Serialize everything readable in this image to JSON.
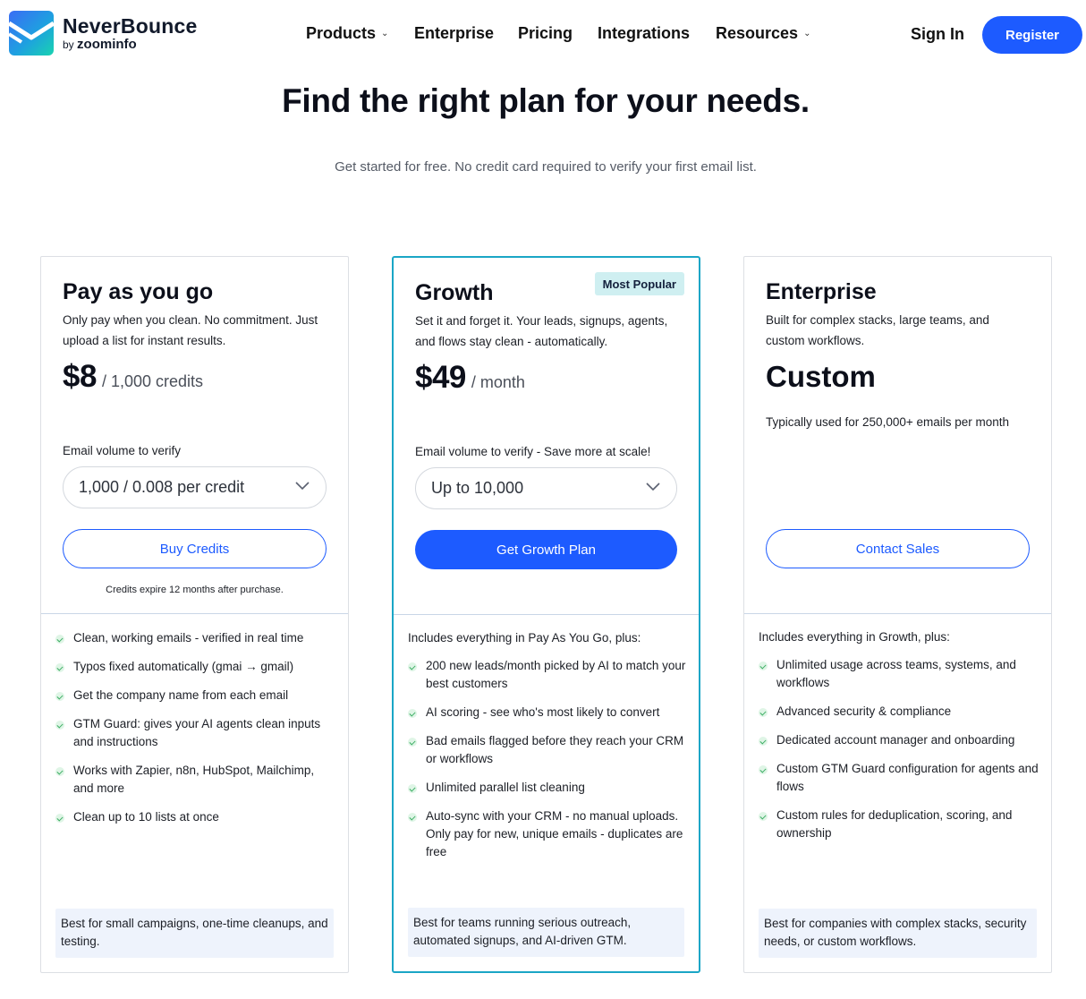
{
  "header": {
    "brand": "NeverBounce",
    "brand_by": "by",
    "brand_parent": "zoominfo",
    "nav": [
      {
        "label": "Products",
        "has_menu": true
      },
      {
        "label": "Enterprise",
        "has_menu": false
      },
      {
        "label": "Pricing",
        "has_menu": false
      },
      {
        "label": "Integrations",
        "has_menu": false
      },
      {
        "label": "Resources",
        "has_menu": true
      }
    ],
    "sign_in": "Sign In",
    "register": "Register",
    "accent": "#1d5bff"
  },
  "hero": {
    "title": "Find the right plan for your needs.",
    "subtitle": "Get started for free. No credit card required to verify your first email list."
  },
  "plans": [
    {
      "name": "Pay as you go",
      "description": "Only pay when you clean. No commitment. Just upload a list for instant results.",
      "price": "$8",
      "price_unit": "/ 1,000 credits",
      "volume_label": "Email volume to verify",
      "volume_selected": "1,000 / 0.008 per credit",
      "cta": "Buy Credits",
      "note": "Credits expire 12 months after purchase.",
      "features": [
        "Clean, working emails - verified in real time",
        "Typos fixed automatically (gmai → gmail)",
        "Get the company name from each email",
        "GTM Guard: gives your AI agents clean inputs and instructions",
        "Works with Zapier, n8n, HubSpot, Mailchimp, and more",
        "Clean up to 10 lists at once"
      ],
      "best_for": "Best for small campaigns, one-time cleanups, and testing."
    },
    {
      "name": "Growth",
      "badge": "Most Popular",
      "description": "Set it and forget it. Your leads, signups, agents, and flows stay clean - automatically.",
      "price": "$49",
      "price_unit": "/ month",
      "volume_label": "Email volume to verify - Save more at scale!",
      "volume_selected": "Up to 10,000",
      "cta": "Get Growth Plan",
      "features_intro": "Includes everything in Pay As You Go, plus:",
      "features": [
        "200 new leads/month picked by AI to match your best customers",
        "AI scoring - see who's most likely to convert",
        "Bad emails flagged before they reach your CRM or workflows",
        "Unlimited parallel list cleaning",
        "Auto-sync with your CRM - no manual uploads. Only pay for new, unique emails - duplicates are free"
      ],
      "best_for": "Best for teams running serious outreach, automated signups, and AI-driven GTM.",
      "border_color": "#1aa6c6"
    },
    {
      "name": "Enterprise",
      "description": "Built for complex stacks, large teams, and custom workflows.",
      "price": "Custom",
      "usage_note": "Typically used for 250,000+ emails per month",
      "cta": "Contact Sales",
      "features_intro": "Includes everything in Growth, plus:",
      "features": [
        "Unlimited usage across teams, systems, and workflows",
        "Advanced security & compliance",
        "Dedicated account manager and onboarding",
        "Custom GTM Guard configuration for agents and flows",
        "Custom rules for deduplication, scoring, and ownership"
      ],
      "best_for": "Best for companies with complex stacks, security needs, or custom workflows."
    }
  ]
}
